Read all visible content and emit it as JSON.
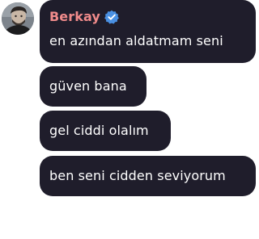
{
  "sender": {
    "name": "Berkay",
    "verified": true,
    "name_color": "#f08b8b",
    "verified_color": "#4a90e2"
  },
  "bubble_color": "#1f1d2b",
  "messages": [
    {
      "text": "en azından aldatmam seni"
    },
    {
      "text": "güven bana"
    },
    {
      "text": "gel ciddi olalım"
    },
    {
      "text": "ben seni cidden seviyorum"
    }
  ]
}
